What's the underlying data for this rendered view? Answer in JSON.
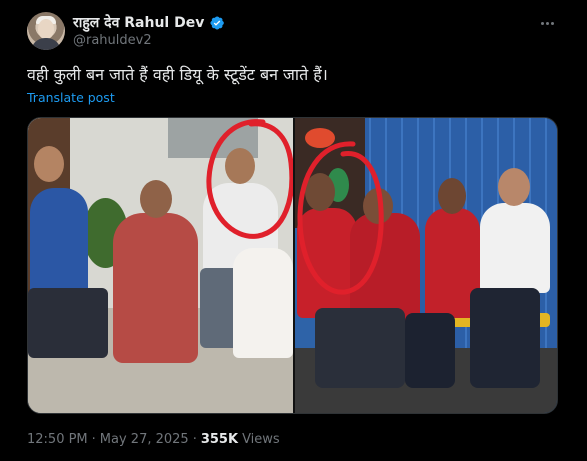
{
  "author": {
    "display_name": "राहुल देव Rahul Dev",
    "handle": "@rahuldev2",
    "verified": true,
    "avatar_icon": "profile-avatar"
  },
  "post": {
    "text": "वही कुली बन जाते हैं वही डियू के स्टूडेंट बन जाते हैं।",
    "translate_label": "Translate post",
    "media": {
      "panels": [
        "left-photo",
        "right-photo"
      ],
      "annotation_color": "#e0202b"
    }
  },
  "meta": {
    "time": "12:50 PM",
    "separator": "·",
    "date": "May 27, 2025",
    "views_count": "355K",
    "views_label": "Views"
  },
  "colors": {
    "background": "#000000",
    "text_primary": "#e7e9ea",
    "text_secondary": "#71767b",
    "link": "#1d9bf0",
    "verified_badge": "#1d9bf0"
  }
}
